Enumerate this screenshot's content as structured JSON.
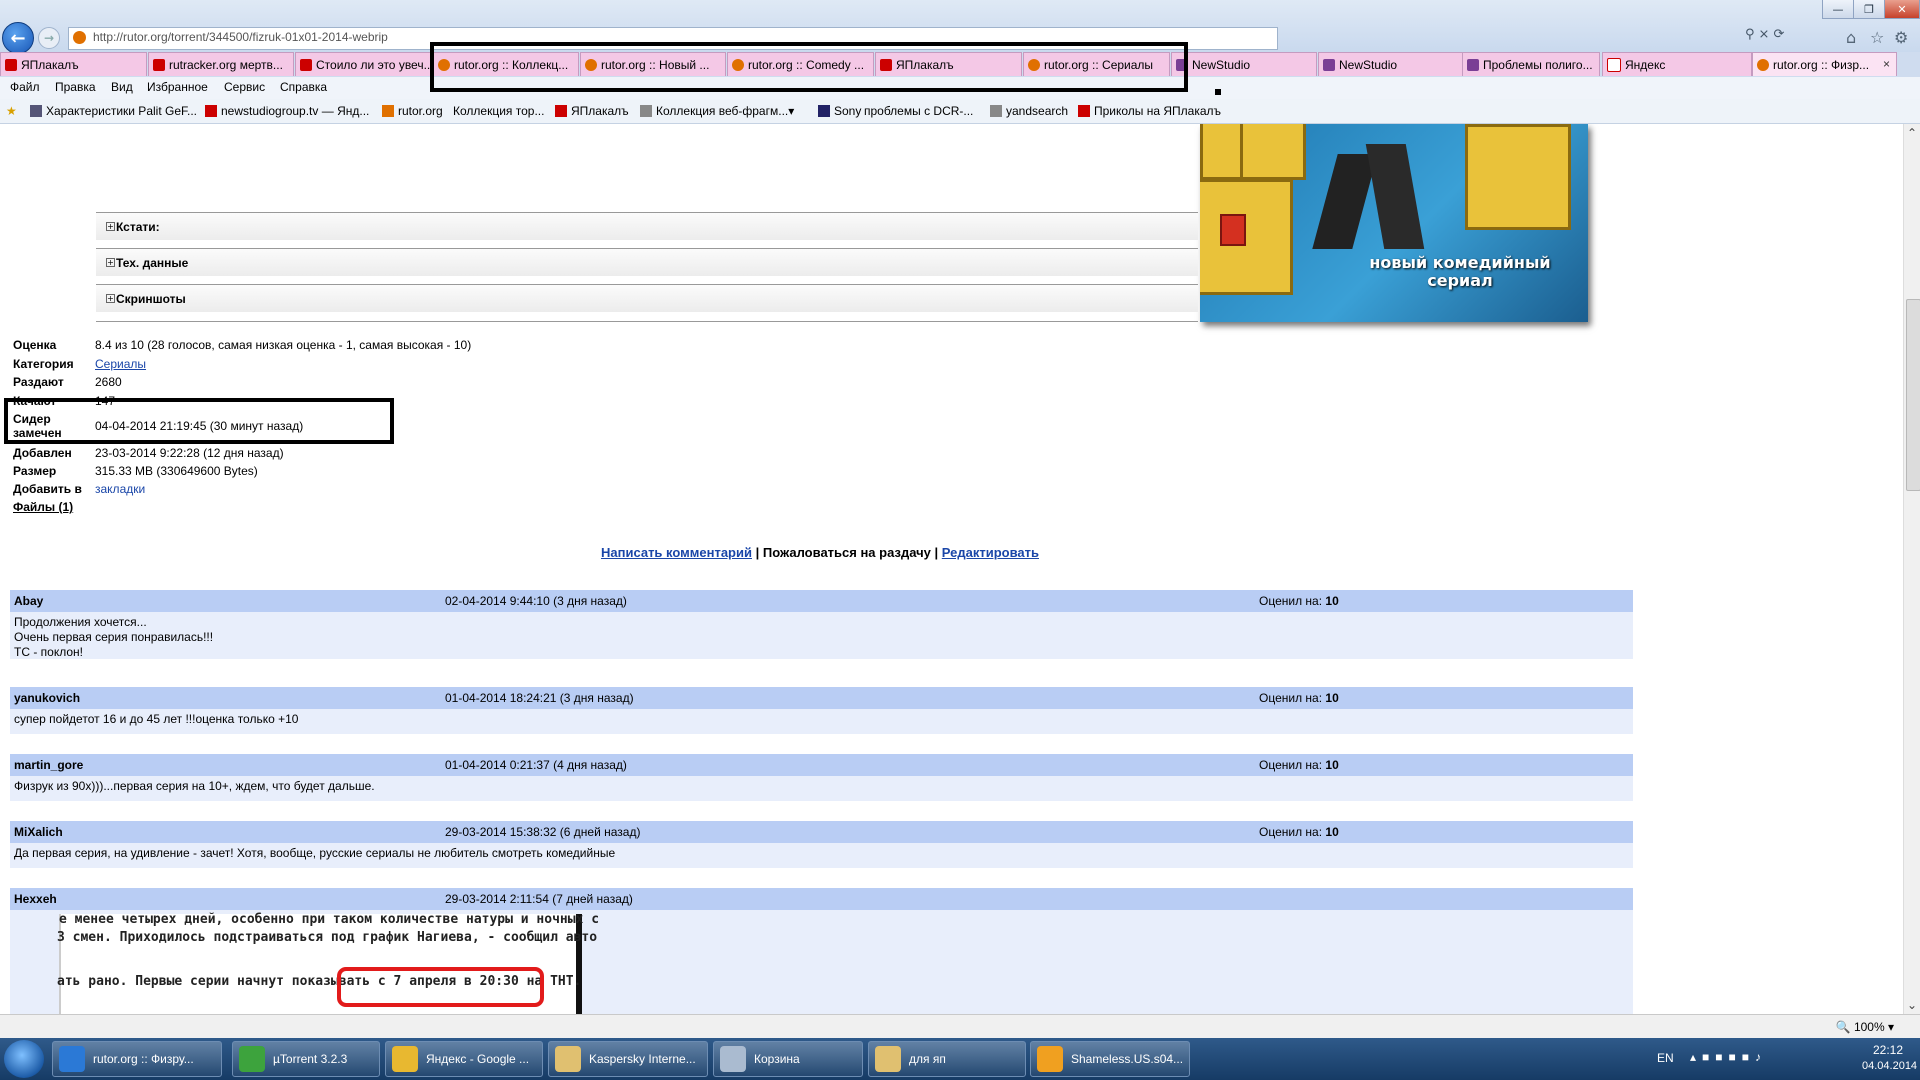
{
  "browser": {
    "url": "http://rutor.org/torrent/344500/fizruk-01x01-2014-webrip",
    "tabs": [
      {
        "label": "ЯПлакалъ",
        "icon": "yap"
      },
      {
        "label": "rutracker.org мертв...",
        "icon": "yap"
      },
      {
        "label": "Стоило ли это увеч...",
        "icon": "yap"
      },
      {
        "label": "rutor.org :: Коллекц...",
        "icon": "rutor"
      },
      {
        "label": "rutor.org :: Новый ...",
        "icon": "rutor"
      },
      {
        "label": "rutor.org :: Comedy ...",
        "icon": "rutor"
      },
      {
        "label": "ЯПлакалъ",
        "icon": "yap"
      },
      {
        "label": "rutor.org :: Сериалы",
        "icon": "rutor"
      },
      {
        "label": "NewStudio",
        "icon": "ns"
      },
      {
        "label": "NewStudio",
        "icon": "ns"
      },
      {
        "label": "Проблемы полиго...",
        "icon": "ns"
      },
      {
        "label": "Яндекс",
        "icon": "yandex"
      },
      {
        "label": "rutor.org :: Физр...",
        "icon": "rutor"
      }
    ],
    "tab_close": "×",
    "menu": [
      "Файл",
      "Правка",
      "Вид",
      "Избранное",
      "Сервис",
      "Справка"
    ],
    "favorites": [
      "Характеристики Palit GeF...",
      "newstudiogroup.tv — Янд...",
      "rutor.org",
      "Коллекция тор...",
      "ЯПлакалъ",
      "Коллекция веб-фрагм...",
      "Sony",
      "проблемы с DCR-...",
      "yandsearch",
      "Приколы на ЯПлакалъ"
    ],
    "zoom": "100%"
  },
  "poster": {
    "text": "новый комедийный сериал"
  },
  "spoilers": [
    "Кстати:",
    "Тех. данные",
    "Скриншоты"
  ],
  "torrent_info": [
    {
      "key": "Оценка",
      "value": "8.4 из 10 (28 голосов, самая низкая оценка - 1, самая высокая - 10)"
    },
    {
      "key": "Категория",
      "value": "Сериалы",
      "link": true
    },
    {
      "key": "Раздают",
      "value": "2680"
    },
    {
      "key": "Качают",
      "value": "147"
    },
    {
      "key": "Сидер замечен",
      "value": "04-04-2014 21:19:45 (30 минут назад)"
    },
    {
      "key": "Добавлен",
      "value": "23-03-2014 9:22:28 (12 дня назад)"
    },
    {
      "key": "Размер",
      "value": "315.33 MB (330649600 Bytes)"
    },
    {
      "key": "Добавить в",
      "value": "закладки",
      "link": true
    },
    {
      "key": "Файлы (1)",
      "value": ""
    }
  ],
  "actions": {
    "write_comment": "Написать комментарий",
    "separator": "|",
    "complain": "Пожаловаться на раздачу",
    "edit": "Редактировать"
  },
  "rated_label": "Оценил на:",
  "comments": [
    {
      "user": "Abay",
      "date": "02-04-2014 9:44:10 (3 дня назад)",
      "rating": "10",
      "lines": [
        "Продолжения хочется...",
        "Очень первая серия понравилась!!!",
        "ТС - поклон!"
      ]
    },
    {
      "user": "yanukovich",
      "date": "01-04-2014 18:24:21 (3 дня назад)",
      "rating": "10",
      "lines": [
        "супер пойдетот 16 и до 45 лет !!!оценка только +10"
      ]
    },
    {
      "user": "martin_gore",
      "date": "01-04-2014 0:21:37 (4 дня назад)",
      "rating": "10",
      "lines": [
        "Физрук из 90х)))...первая серия на 10+, ждем, что будет дальше."
      ]
    },
    {
      "user": "MiXalich",
      "date": "29-03-2014 15:38:32 (6 дней назад)",
      "rating": "10",
      "lines": [
        "Да первая серия, на удивление - зачет! Хотя, вообще, русские сериалы не любитель смотреть комедийные"
      ]
    },
    {
      "user": "Нexxeh",
      "date": "29-03-2014 2:11:54 (7 дней назад)",
      "rating": "",
      "lines": []
    }
  ],
  "scan_text": [
    "е менее четырех дней, особенно при таком количестве натуры и ночных с",
    "3 смен. Приходилось подстраиваться под график Нагиева, - сообщил авто",
    "ать рано. Первые серии начнут показывать с 7 апреля в 20:30 на ТНТ."
  ],
  "taskbar": [
    {
      "label": "rutor.org :: Физру...",
      "color": "#2b79d6"
    },
    {
      "label": "µTorrent 3.2.3",
      "color": "#3da33d"
    },
    {
      "label": "Яндекс - Google ...",
      "color": "#e8b830"
    },
    {
      "label": "Kaspersky Interne...",
      "color": "#e0c070"
    },
    {
      "label": "Корзина",
      "color": "#aabbd0"
    },
    {
      "label": "для яп",
      "color": "#e0c070"
    },
    {
      "label": "Shameless.US.s04...",
      "color": "#f0a020"
    }
  ],
  "tray": {
    "lang": "EN",
    "time": "22:12",
    "date": "04.04.2014"
  }
}
